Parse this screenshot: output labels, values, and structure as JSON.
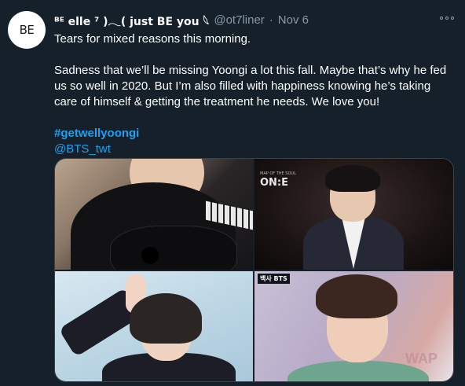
{
  "author": {
    "avatar_text": "BE",
    "display_name": "ᴮᴱ elle ⁷ )𓂃( just BE you 𓆩",
    "handle": "@ot7liner",
    "separator": "·",
    "date": "Nov 6"
  },
  "tweet": {
    "line1": "Tears for mixed reasons this morning.",
    "line2": "Sadness that we’ll be missing Yoongi a lot this fall. Maybe that’s why he fed us so well in 2020. But I’m also filled with happiness knowing he’s taking care of himself & getting the treatment he needs. We love you!",
    "hashtag": "#getwellyoongi",
    "mention": "@BTS_twt"
  },
  "media": {
    "photo2_logo": "ON:E",
    "photo2_logo_small": "MAP OF THE SOUL",
    "photo4_tag": "백사 BTS",
    "photo4_sign": "WAP"
  },
  "icons": {
    "more": "more-horizontal-icon"
  },
  "colors": {
    "background": "#15202b",
    "text_primary": "#ffffff",
    "text_secondary": "#8899a6",
    "link": "#1da1f2",
    "border": "#38444d"
  }
}
